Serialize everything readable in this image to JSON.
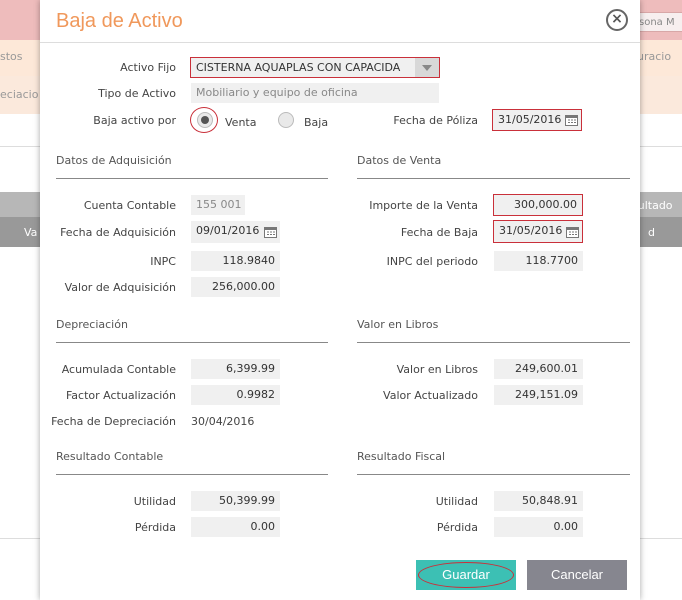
{
  "background": {
    "top_right_text": "sona M",
    "left_text1": "stos",
    "left_text2": "eciacio",
    "right_text1": "guracio",
    "table_left_text": "Va",
    "table_right_text1": "sultado",
    "table_right_text2": "d"
  },
  "modal": {
    "title": "Baja de Activo",
    "close_symbol": "×",
    "activo_fijo": {
      "label": "Activo Fijo",
      "value": "CISTERNA AQUAPLAS CON CAPACIDA"
    },
    "tipo_activo": {
      "label": "Tipo de Activo",
      "value": "Mobiliario y equipo de oficina"
    },
    "baja_por": {
      "label": "Baja activo por",
      "options": [
        {
          "label": "Venta",
          "selected": true
        },
        {
          "label": "Baja",
          "selected": false
        }
      ]
    },
    "fecha_poliza": {
      "label": "Fecha de Póliza",
      "value": "31/05/2016"
    },
    "adquisicion": {
      "title": "Datos de Adquisición",
      "cuenta_contable": {
        "label": "Cuenta Contable",
        "value": "155 001"
      },
      "fecha_adquisicion": {
        "label": "Fecha de Adquisición",
        "value": "09/01/2016"
      },
      "inpc": {
        "label": "INPC",
        "value": "118.9840"
      },
      "valor_adquisicion": {
        "label": "Valor de Adquisición",
        "value": "256,000.00"
      }
    },
    "venta": {
      "title": "Datos de Venta",
      "importe_venta": {
        "label": "Importe de la Venta",
        "value": "300,000.00"
      },
      "fecha_baja": {
        "label": "Fecha de Baja",
        "value": "31/05/2016"
      },
      "inpc_periodo": {
        "label": "INPC del periodo",
        "value": "118.7700"
      }
    },
    "depreciacion": {
      "title": "Depreciación",
      "acumulada": {
        "label": "Acumulada Contable",
        "value": "6,399.99"
      },
      "factor": {
        "label": "Factor Actualización",
        "value": "0.9982"
      },
      "fecha": {
        "label": "Fecha de Depreciación",
        "value": "30/04/2016"
      }
    },
    "valor_libros": {
      "title": "Valor en Libros",
      "valor": {
        "label": "Valor en Libros",
        "value": "249,600.01"
      },
      "actualizado": {
        "label": "Valor Actualizado",
        "value": "249,151.09"
      }
    },
    "resultado_contable": {
      "title": "Resultado Contable",
      "utilidad": {
        "label": "Utilidad",
        "value": "50,399.99"
      },
      "perdida": {
        "label": "Pérdida",
        "value": "0.00"
      }
    },
    "resultado_fiscal": {
      "title": "Resultado Fiscal",
      "utilidad": {
        "label": "Utilidad",
        "value": "50,848.91"
      },
      "perdida": {
        "label": "Pérdida",
        "value": "0.00"
      }
    },
    "buttons": {
      "save": "Guardar",
      "cancel": "Cancelar"
    }
  },
  "colors": {
    "title_orange": "#f0985b",
    "save_teal": "#3cc0b4",
    "cancel_gray": "#86868f",
    "highlight_red": "#c9303a"
  },
  "icons": [
    "close-icon",
    "calendar-icon",
    "dropdown-arrow-icon"
  ]
}
